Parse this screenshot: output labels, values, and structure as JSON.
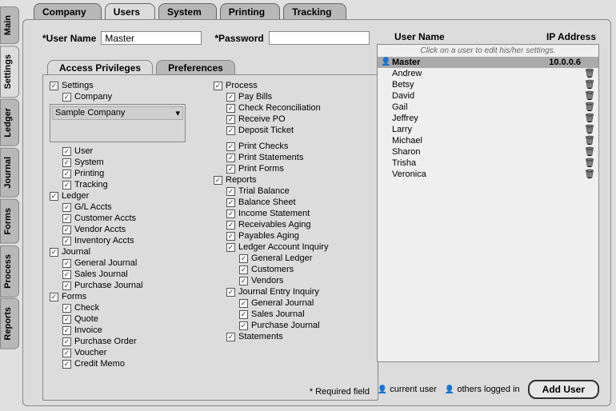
{
  "side_tabs": [
    "Main",
    "Settings",
    "Ledger",
    "Journal",
    "Forms",
    "Process",
    "Reports"
  ],
  "side_active": "Settings",
  "top_tabs": [
    "Company",
    "Users",
    "System",
    "Printing",
    "Tracking"
  ],
  "top_active": "Users",
  "form": {
    "username_label": "*User Name",
    "username_value": "Master",
    "password_label": "*Password",
    "password_value": ""
  },
  "sub_tabs": [
    "Access Privileges",
    "Preferences"
  ],
  "sub_active": "Access Privileges",
  "company_select": {
    "value": "Sample Company"
  },
  "privileges_col1": [
    {
      "label": "Settings",
      "indent": 0,
      "checked": true,
      "children": [
        {
          "label": "Company",
          "indent": 1,
          "checked": true,
          "company_box": true
        },
        {
          "label": "User",
          "indent": 1,
          "checked": true
        },
        {
          "label": "System",
          "indent": 1,
          "checked": true
        },
        {
          "label": "Printing",
          "indent": 1,
          "checked": true
        },
        {
          "label": "Tracking",
          "indent": 1,
          "checked": true
        }
      ]
    },
    {
      "label": "Ledger",
      "indent": 0,
      "checked": true,
      "children": [
        {
          "label": "G/L Accts",
          "indent": 1,
          "checked": true
        },
        {
          "label": "Customer Accts",
          "indent": 1,
          "checked": true
        },
        {
          "label": "Vendor Accts",
          "indent": 1,
          "checked": true
        },
        {
          "label": "Inventory Accts",
          "indent": 1,
          "checked": true
        }
      ]
    },
    {
      "label": "Journal",
      "indent": 0,
      "checked": true,
      "children": [
        {
          "label": "General Journal",
          "indent": 1,
          "checked": true
        },
        {
          "label": "Sales Journal",
          "indent": 1,
          "checked": true
        },
        {
          "label": "Purchase Journal",
          "indent": 1,
          "checked": true
        }
      ]
    },
    {
      "label": "Forms",
      "indent": 0,
      "checked": true,
      "children": [
        {
          "label": "Check",
          "indent": 1,
          "checked": true
        },
        {
          "label": "Quote",
          "indent": 1,
          "checked": true
        },
        {
          "label": "Invoice",
          "indent": 1,
          "checked": true
        },
        {
          "label": "Purchase Order",
          "indent": 1,
          "checked": true
        },
        {
          "label": "Voucher",
          "indent": 1,
          "checked": true
        },
        {
          "label": "Credit Memo",
          "indent": 1,
          "checked": true
        }
      ]
    }
  ],
  "privileges_col2": [
    {
      "label": "Process",
      "indent": 0,
      "checked": true,
      "children": [
        {
          "label": "Pay Bills",
          "indent": 1,
          "checked": true
        },
        {
          "label": "Check Reconciliation",
          "indent": 1,
          "checked": true
        },
        {
          "label": "Receive PO",
          "indent": 1,
          "checked": true
        },
        {
          "label": "Deposit Ticket",
          "indent": 1,
          "checked": true
        },
        {
          "gap": true
        },
        {
          "label": "Print Checks",
          "indent": 1,
          "checked": true
        },
        {
          "label": "Print Statements",
          "indent": 1,
          "checked": true
        },
        {
          "label": "Print Forms",
          "indent": 1,
          "checked": true
        }
      ]
    },
    {
      "label": "Reports",
      "indent": 0,
      "checked": true,
      "children": [
        {
          "label": "Trial Balance",
          "indent": 1,
          "checked": true
        },
        {
          "label": "Balance Sheet",
          "indent": 1,
          "checked": true
        },
        {
          "label": "Income Statement",
          "indent": 1,
          "checked": true
        },
        {
          "label": "Receivables Aging",
          "indent": 1,
          "checked": true
        },
        {
          "label": "Payables Aging",
          "indent": 1,
          "checked": true
        },
        {
          "label": "Ledger Account Inquiry",
          "indent": 1,
          "checked": true
        },
        {
          "label": "General Ledger",
          "indent": 2,
          "checked": true
        },
        {
          "label": "Customers",
          "indent": 2,
          "checked": true
        },
        {
          "label": "Vendors",
          "indent": 2,
          "checked": true
        }
      ]
    },
    {
      "label": "Journal Entry Inquiry",
      "indent": 1,
      "checked": true,
      "children": [
        {
          "label": "General Journal",
          "indent": 2,
          "checked": true
        },
        {
          "label": "Sales Journal",
          "indent": 2,
          "checked": true
        },
        {
          "label": "Purchase Journal",
          "indent": 2,
          "checked": true
        }
      ]
    },
    {
      "label": "Statements",
      "indent": 1,
      "checked": true
    }
  ],
  "required_note": "* Required field",
  "user_list": {
    "header_name": "User Name",
    "header_ip": "IP Address",
    "hint": "Click on a user to edit his/her settings.",
    "rows": [
      {
        "name": "Master",
        "ip": "10.0.0.6",
        "selected": true,
        "current": true,
        "trash": false
      },
      {
        "name": "Andrew",
        "ip": "",
        "selected": false,
        "trash": true
      },
      {
        "name": "Betsy",
        "ip": "",
        "selected": false,
        "trash": true
      },
      {
        "name": "David",
        "ip": "",
        "selected": false,
        "trash": true
      },
      {
        "name": "Gail",
        "ip": "",
        "selected": false,
        "trash": true
      },
      {
        "name": "Jeffrey",
        "ip": "",
        "selected": false,
        "trash": true
      },
      {
        "name": "Larry",
        "ip": "",
        "selected": false,
        "trash": true
      },
      {
        "name": "Michael",
        "ip": "",
        "selected": false,
        "trash": true
      },
      {
        "name": "Sharon",
        "ip": "",
        "selected": false,
        "trash": true
      },
      {
        "name": "Trisha",
        "ip": "",
        "selected": false,
        "trash": true
      },
      {
        "name": "Veronica",
        "ip": "",
        "selected": false,
        "trash": true
      }
    ]
  },
  "legend": {
    "current": "current user",
    "others": "others logged in"
  },
  "add_user_label": "Add User"
}
